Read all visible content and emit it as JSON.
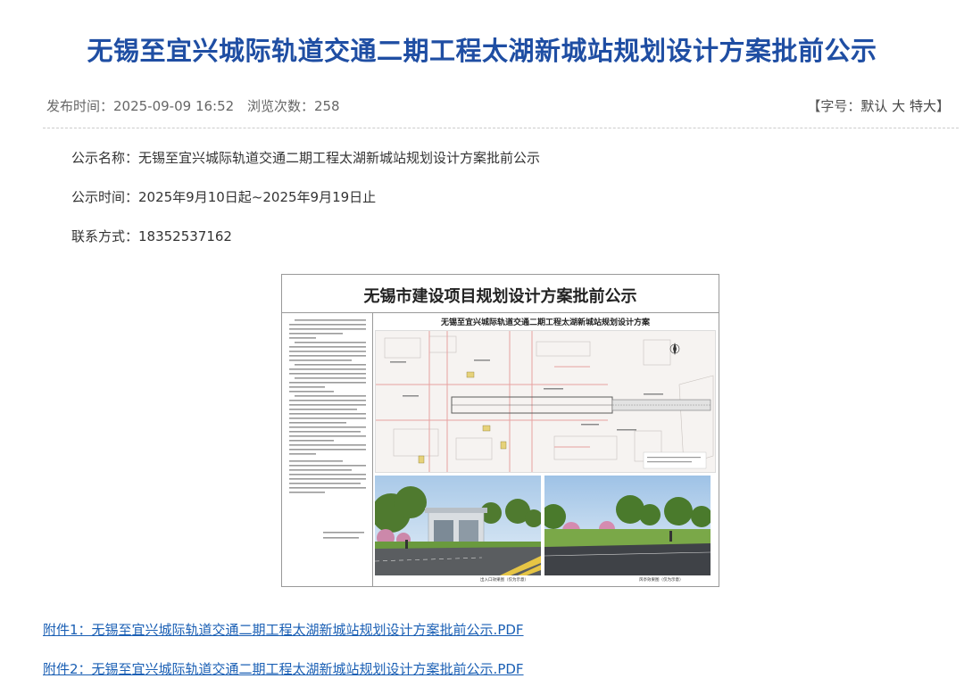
{
  "article": {
    "title": "无锡至宜兴城际轨道交通二期工程太湖新城站规划设计方案批前公示",
    "publish_time": "发布时间：2025-09-09 16:52",
    "views": "浏览次数：258",
    "font_size": {
      "prefix": "【字号：",
      "default": "默认",
      "large": "大",
      "xlarge": "特大",
      "suffix": "】"
    },
    "info": {
      "name": "公示名称：无锡至宜兴城际轨道交通二期工程太湖新城站规划设计方案批前公示",
      "time": "公示时间：2025年9月10日起~2025年9月19日止",
      "contact": "联系方式：18352537162"
    }
  },
  "notice_image": {
    "title": "无锡市建设项目规划设计方案批前公示",
    "subtitle": "无锡至宜兴城际轨道交通二期工程太湖新城站规划设计方案",
    "caption_left": "出入口效果图（仅为示意）",
    "caption_right": "风亭效果图（仅为示意）",
    "plan_legend": "总平面图"
  },
  "attachments": [
    "附件1：无锡至宜兴城际轨道交通二期工程太湖新城站规划设计方案批前公示.PDF",
    "附件2：无锡至宜兴城际轨道交通二期工程太湖新城站规划设计方案批前公示.PDF"
  ],
  "colors": {
    "title": "#1f4ea3",
    "link": "#1a5fb4",
    "plan_road": "#e8a3a3",
    "plan_track": "#7a7a7a",
    "sky": "#bcd6ee",
    "grass": "#6a9a3e"
  }
}
